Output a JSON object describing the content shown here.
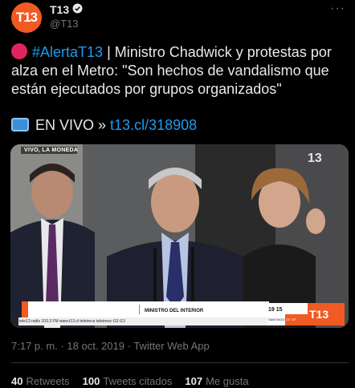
{
  "account": {
    "avatar_text": "T13",
    "name": "T13",
    "handle": "@T13"
  },
  "tweet": {
    "hashtag": "#AlertaT13",
    "text": " | Ministro Chadwick y protestas por alza en el Metro: \"Son hechos de vandalismo que están ejecutados por grupos organizados\"",
    "live_label": "EN VIVO »",
    "link": "t13.cl/318908"
  },
  "media": {
    "live_tag": "VIVO, LA MONEDA",
    "lower_third_name": "ANDRÉS CHADWICK",
    "lower_third_role": "MINISTRO DEL INTERIOR",
    "ticker": "tele13 radio 103.3 FM   www.t13.cl   teletrece   teletrece   t13   t13",
    "clock": "19 15",
    "city": "SANTIAGO",
    "temperature": "24° 25°",
    "channel_logo": "T13",
    "watermark_logo": "13"
  },
  "meta": {
    "time": "7:17 p. m.",
    "separator": "·",
    "date": "18 oct. 2019",
    "source": "Twitter Web App"
  },
  "stats": {
    "retweets_count": "40",
    "retweets_label": "Retweets",
    "quotes_count": "100",
    "quotes_label": "Tweets citados",
    "likes_count": "107",
    "likes_label": "Me gusta"
  },
  "colors": {
    "brand_orange": "#f15a22",
    "link_blue": "#1d9bf0",
    "alert_red": "#e0245e"
  }
}
